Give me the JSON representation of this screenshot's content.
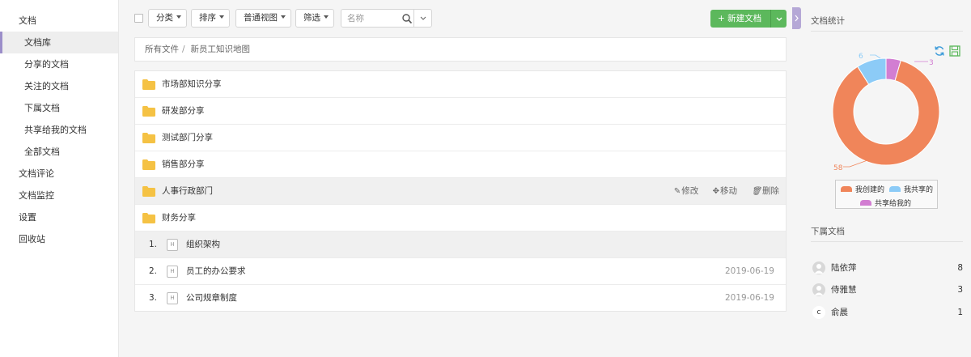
{
  "sidebar": {
    "items": [
      {
        "label": "文档"
      },
      {
        "label": "文档库"
      },
      {
        "label": "分享的文档"
      },
      {
        "label": "关注的文档"
      },
      {
        "label": "下属文档"
      },
      {
        "label": "共享给我的文档"
      },
      {
        "label": "全部文档"
      },
      {
        "label": "文档评论"
      },
      {
        "label": "文档监控"
      },
      {
        "label": "设置"
      },
      {
        "label": "回收站"
      }
    ]
  },
  "toolbar": {
    "category_label": "分类",
    "sort_label": "排序",
    "view_label": "普通视图",
    "filter_label": "筛选",
    "search_placeholder": "名称",
    "new_doc_label": "+ 新建文档"
  },
  "breadcrumb": {
    "root": "所有文件",
    "separator": "/",
    "current": "新员工知识地图"
  },
  "folders": [
    {
      "name": "市场部知识分享"
    },
    {
      "name": "研发部分享"
    },
    {
      "name": "测试部门分享"
    },
    {
      "name": "销售部分享"
    },
    {
      "name": "人事行政部门"
    },
    {
      "name": "财务分享"
    }
  ],
  "row_actions": {
    "edit": "修改",
    "move": "移动",
    "delete": "删除"
  },
  "documents": [
    {
      "index": "1.",
      "type": "H",
      "name": "组织架构",
      "date": ""
    },
    {
      "index": "2.",
      "type": "H",
      "name": "员工的办公要求",
      "date": "2019-06-19"
    },
    {
      "index": "3.",
      "type": "H",
      "name": "公司规章制度",
      "date": "2019-06-19"
    }
  ],
  "stats": {
    "title": "文档统计",
    "labels": {
      "created": "58",
      "shared": "6",
      "shared_to_me": "3"
    },
    "legend": {
      "created": "我创建的",
      "shared": "我共享的",
      "shared_to_me": "共享给我的"
    }
  },
  "chart_data": {
    "type": "pie",
    "categories": [
      "我创建的",
      "我共享的",
      "共享给我的"
    ],
    "values": [
      58,
      6,
      3
    ],
    "colors": [
      "#f0855a",
      "#8ccbf7",
      "#d27ed2"
    ],
    "legend_position": "bottom"
  },
  "subordinates": {
    "title": "下属文档",
    "items": [
      {
        "name": "陆依萍",
        "count": "8",
        "avatar": ""
      },
      {
        "name": "侍雅慧",
        "count": "3",
        "avatar": ""
      },
      {
        "name": "俞晨",
        "count": "1",
        "avatar": "c"
      }
    ]
  },
  "colors": {
    "primary_green": "#5cb85c",
    "accent_purple": "#9b8ec9",
    "folder_yellow": "#f5c244"
  }
}
